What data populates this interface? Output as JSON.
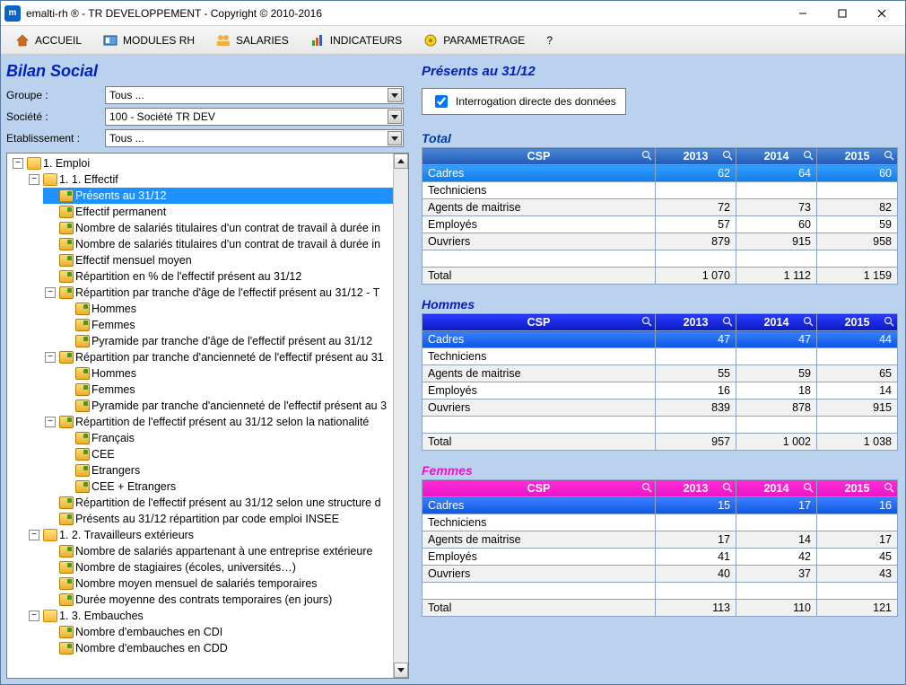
{
  "window": {
    "title": "emalti-rh ® - TR DEVELOPPEMENT - Copyright © 2010-2016",
    "appicon_letter": "m"
  },
  "menu": {
    "items": [
      {
        "key": "accueil",
        "label": "ACCUEIL"
      },
      {
        "key": "modules",
        "label": "MODULES RH"
      },
      {
        "key": "salaries",
        "label": "SALARIES"
      },
      {
        "key": "indicateurs",
        "label": "INDICATEURS"
      },
      {
        "key": "parametrage",
        "label": "PARAMETRAGE"
      },
      {
        "key": "help",
        "label": "?"
      }
    ]
  },
  "page": {
    "heading": "Bilan Social",
    "filters": {
      "groupe_label": "Groupe :",
      "groupe_value": "Tous ...",
      "societe_label": "Société :",
      "societe_value": "100 - Société TR DEV",
      "etab_label": "Etablissement :",
      "etab_value": "Tous ..."
    }
  },
  "tree": {
    "root": "1. Emploi",
    "n11": "1. 1. Effectif",
    "n11_items": [
      "Présents au 31/12",
      "Effectif permanent",
      "Nombre de salariés titulaires d'un contrat de travail à durée in",
      "Nombre de salariés titulaires d'un contrat de travail à durée in",
      "Effectif mensuel moyen",
      "Répartition en % de l'effectif présent au 31/12"
    ],
    "n11_age": "Répartition par tranche d'âge de l'effectif présent au 31/12 - T",
    "n11_age_items": [
      "Hommes",
      "Femmes",
      "Pyramide par tranche d'âge de l'effectif présent au 31/12"
    ],
    "n11_anc": "Répartition par tranche d'ancienneté de l'effectif présent au 31",
    "n11_anc_items": [
      "Hommes",
      "Femmes",
      "Pyramide par tranche d'ancienneté de l'effectif présent au 3"
    ],
    "n11_nat": "Répartition de l'effectif présent au 31/12 selon la nationalité",
    "n11_nat_items": [
      "Français",
      "CEE",
      "Etrangers",
      "CEE + Etrangers"
    ],
    "n11_tail": [
      "Répartition de l'effectif présent au 31/12 selon une structure d",
      "Présents au 31/12 répartition par code emploi INSEE"
    ],
    "n12": "1. 2. Travailleurs extérieurs",
    "n12_items": [
      "Nombre de salariés appartenant à une entreprise extérieure",
      "Nombre de stagiaires (écoles, universités…)",
      "Nombre moyen mensuel de salariés temporaires",
      "Durée moyenne des contrats temporaires (en jours)"
    ],
    "n13": "1. 3. Embauches",
    "n13_items": [
      "Nombre d'embauches en CDI",
      "Nombre d'embauches en CDD"
    ]
  },
  "right": {
    "subheading": "Présents au 31/12",
    "checkbox_label": "Interrogation directe des données",
    "checkbox_checked": true,
    "col_csp": "CSP",
    "years": [
      "2013",
      "2014",
      "2015"
    ],
    "row_labels": [
      "Cadres",
      "Techniciens",
      "Agents de maitrise",
      "Employés",
      "Ouvriers"
    ],
    "total_label": "Total",
    "sections": [
      {
        "key": "total",
        "title": "Total",
        "class": "sect-total",
        "rows": [
          {
            "cells": [
              "62",
              "64",
              "60"
            ],
            "hi": true
          },
          {
            "cells": [
              "",
              "",
              ""
            ]
          },
          {
            "cells": [
              "72",
              "73",
              "82"
            ]
          },
          {
            "cells": [
              "57",
              "60",
              "59"
            ]
          },
          {
            "cells": [
              "879",
              "915",
              "958"
            ]
          }
        ],
        "totals": [
          "1 070",
          "1 112",
          "1 159"
        ]
      },
      {
        "key": "hommes",
        "title": "Hommes",
        "class": "sect-hommes",
        "rows": [
          {
            "cells": [
              "47",
              "47",
              "44"
            ],
            "hi": true
          },
          {
            "cells": [
              "",
              "",
              ""
            ]
          },
          {
            "cells": [
              "55",
              "59",
              "65"
            ]
          },
          {
            "cells": [
              "16",
              "18",
              "14"
            ]
          },
          {
            "cells": [
              "839",
              "878",
              "915"
            ]
          }
        ],
        "totals": [
          "957",
          "1 002",
          "1 038"
        ]
      },
      {
        "key": "femmes",
        "title": "Femmes",
        "class": "sect-femmes",
        "rows": [
          {
            "cells": [
              "15",
              "17",
              "16"
            ],
            "hi": true
          },
          {
            "cells": [
              "",
              "",
              ""
            ]
          },
          {
            "cells": [
              "17",
              "14",
              "17"
            ]
          },
          {
            "cells": [
              "41",
              "42",
              "45"
            ]
          },
          {
            "cells": [
              "40",
              "37",
              "43"
            ]
          }
        ],
        "totals": [
          "113",
          "110",
          "121"
        ]
      }
    ]
  }
}
